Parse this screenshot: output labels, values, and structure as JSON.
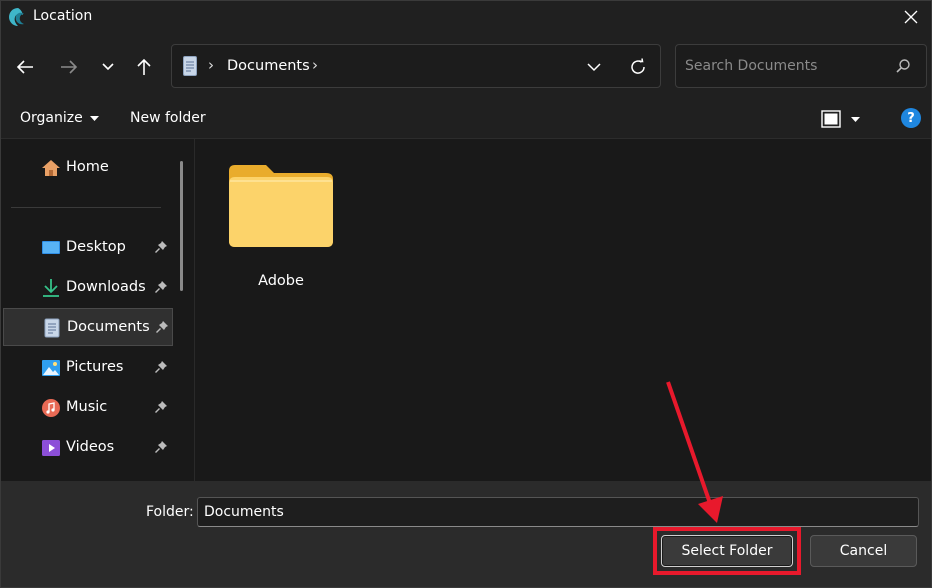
{
  "window": {
    "title": "Location"
  },
  "nav": {
    "address_segment": "Documents",
    "address_sep": "›",
    "search_placeholder": "Search Documents"
  },
  "commands": {
    "organize": "Organize",
    "new_folder": "New folder",
    "help": "?"
  },
  "sidebar": {
    "items": [
      {
        "label": "Home",
        "icon": "home-icon",
        "pinned": false
      },
      {
        "label": "Desktop",
        "icon": "desktop-icon",
        "pinned": true
      },
      {
        "label": "Downloads",
        "icon": "download-icon",
        "pinned": true
      },
      {
        "label": "Documents",
        "icon": "documents-icon",
        "pinned": true,
        "selected": true
      },
      {
        "label": "Pictures",
        "icon": "pictures-icon",
        "pinned": true
      },
      {
        "label": "Music",
        "icon": "music-icon",
        "pinned": true
      },
      {
        "label": "Videos",
        "icon": "videos-icon",
        "pinned": true
      }
    ]
  },
  "content": {
    "items": [
      {
        "label": "Adobe",
        "type": "folder"
      }
    ]
  },
  "footer": {
    "folder_label": "Folder:",
    "folder_value": "Documents",
    "select_button": "Select Folder",
    "cancel_button": "Cancel"
  },
  "colors": {
    "highlight": "#e8192c",
    "folder": "#f8c94a",
    "help": "#1f87e0"
  }
}
